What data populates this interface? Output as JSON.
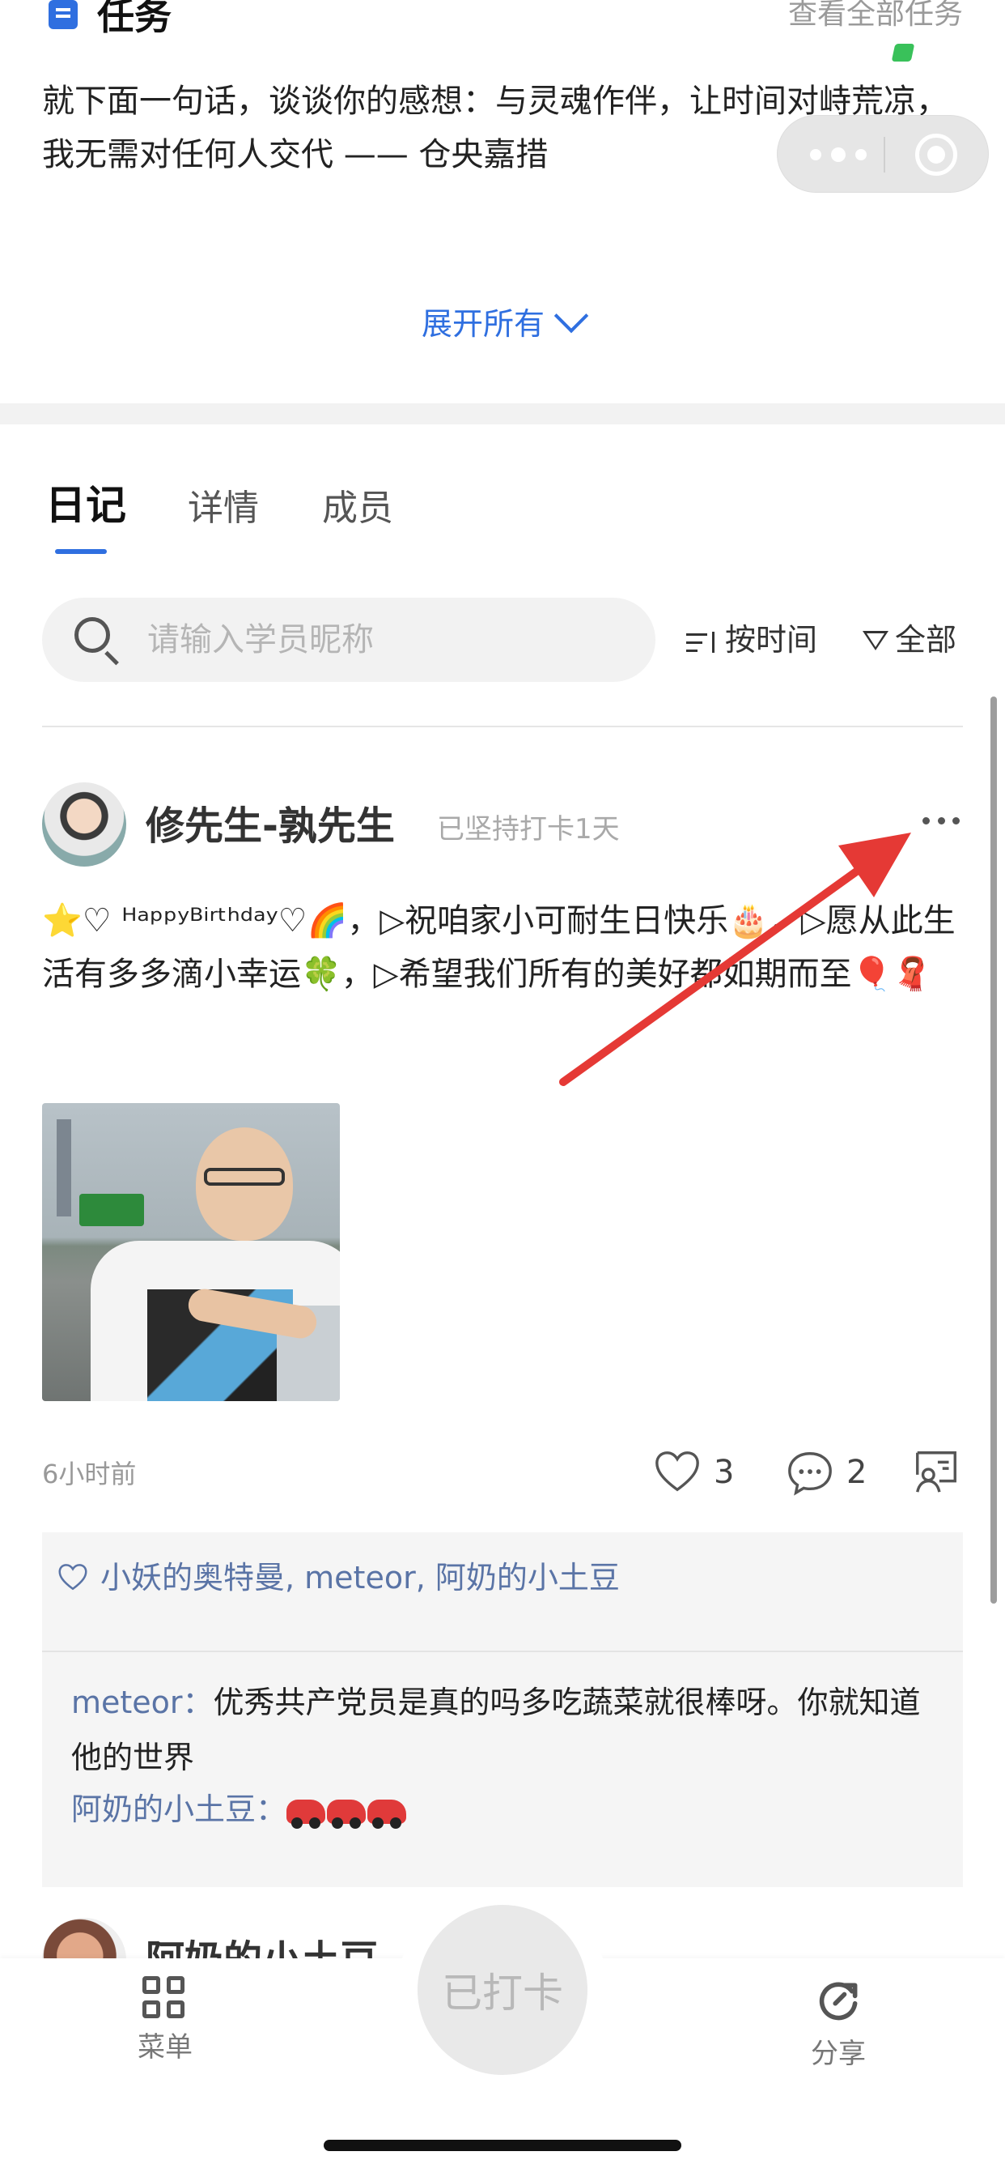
{
  "task": {
    "title": "任务",
    "view_all": "查看全部任务",
    "text": "就下面一句话，谈谈你的感想：与灵魂作伴，让时间对峙荒凉，我无需对任何人交代 —— 仓央嘉措",
    "expand_all": "展开所有"
  },
  "tabs": [
    {
      "label": "日记",
      "active": true
    },
    {
      "label": "详情",
      "active": false
    },
    {
      "label": "成员",
      "active": false
    }
  ],
  "search": {
    "placeholder": "请输入学员昵称",
    "value": ""
  },
  "sort": {
    "label": "按时间"
  },
  "filter": {
    "label": "全部"
  },
  "post": {
    "author": "修先生-孰先生",
    "streak": "已坚持打卡1天",
    "body": "⭐♡ ᴴᵃᵖᵖʸᴮⁱʳᵗʰᵈᵃʸ♡🌈，▷祝咱家小可耐生日快乐🎂，▷愿从此生活有多多滴小幸运🍀，▷希望我们所有的美好都如期而至🎈🧣",
    "time": "6小时前",
    "likes_count": "3",
    "comments_count": "2",
    "liked_by": "小妖的奥特曼, meteor, 阿奶的小土豆",
    "comments": [
      {
        "author": "meteor：",
        "text": "优秀共产党员是真的吗多吃蔬菜就很棒呀。你就知道他的世界"
      },
      {
        "author": "阿奶的小土豆：",
        "text": ""
      }
    ]
  },
  "next_post": {
    "author": "阿奶的小土豆"
  },
  "bottom_nav": {
    "menu": "菜单",
    "checkin": "已打卡",
    "share": "分享"
  },
  "colors": {
    "accent": "#2f6fe0",
    "link": "#5a74a6",
    "annotation_arrow": "#e53935"
  },
  "icons": [
    "document-icon",
    "search-icon",
    "sort-icon",
    "filter-icon",
    "more-icon",
    "heart-icon",
    "comment-icon",
    "share-card-icon",
    "grid-menu-icon",
    "refresh-share-icon",
    "capsule-more-icon",
    "capsule-close-icon"
  ]
}
